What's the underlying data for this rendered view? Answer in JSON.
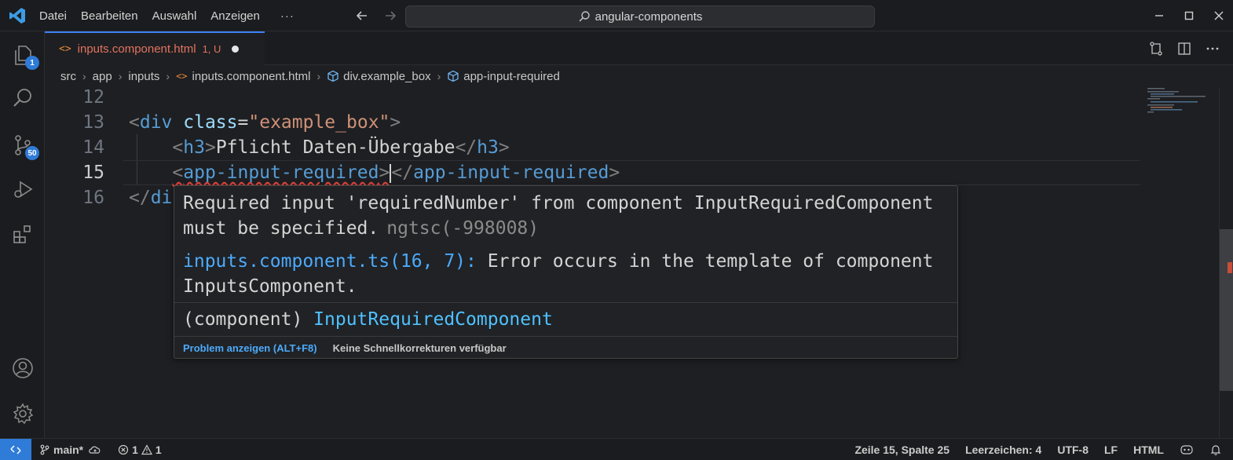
{
  "titlebar": {
    "menu": [
      "Datei",
      "Bearbeiten",
      "Auswahl",
      "Anzeigen"
    ],
    "more": "···",
    "search_text": "angular-components"
  },
  "activity": {
    "explorer_badge": "1",
    "scm_badge": "50"
  },
  "tab": {
    "name": "inputs.component.html",
    "status": "1, U"
  },
  "breadcrumb": {
    "parts": [
      "src",
      "app",
      "inputs"
    ],
    "file": "inputs.component.html",
    "symbols": [
      "div.example_box",
      "app-input-required"
    ]
  },
  "editor": {
    "line_numbers": [
      "12",
      "13",
      "14",
      "15",
      "16"
    ],
    "l13": {
      "open": "<",
      "tag": "div",
      "sp": " ",
      "attr": "class",
      "eq": "=",
      "val": "\"example_box\"",
      "close": ">"
    },
    "l14": {
      "indent": "    ",
      "o1": "<",
      "tag1": "h3",
      "c1": ">",
      "text": "Pflicht Daten-Übergabe",
      "o2": "</",
      "tag2": "h3",
      "c2": ">"
    },
    "l15": {
      "indent": "    ",
      "o1": "<",
      "tag1": "app-input-required",
      "c1": ">",
      "o2": "</",
      "tag2": "app-input-required",
      "c2": ">"
    },
    "l16": {
      "o1": "</",
      "tag1": "di"
    }
  },
  "hover": {
    "message": "Required input 'requiredNumber' from component InputRequiredComponent must be specified.",
    "code": "ngtsc(-998008)",
    "related_link": "inputs.component.ts(16, 7):",
    "related_text": " Error occurs in the template of component InputsComponent.",
    "sig_kind": "(component) ",
    "sig_type": "InputRequiredComponent",
    "action_view": "Problem anzeigen (ALT+F8)",
    "action_fix": "Keine Schnellkorrekturen verfügbar"
  },
  "statusbar": {
    "branch": "main*",
    "errors": "1",
    "warnings": "1",
    "position": "Zeile 15, Spalte 25",
    "indent": "Leerzeichen: 4",
    "encoding": "UTF-8",
    "eol": "LF",
    "language": "HTML"
  },
  "colors": {
    "accent": "#2f7bd8",
    "error": "#e0443e",
    "tab_modified": "#e2735f"
  }
}
